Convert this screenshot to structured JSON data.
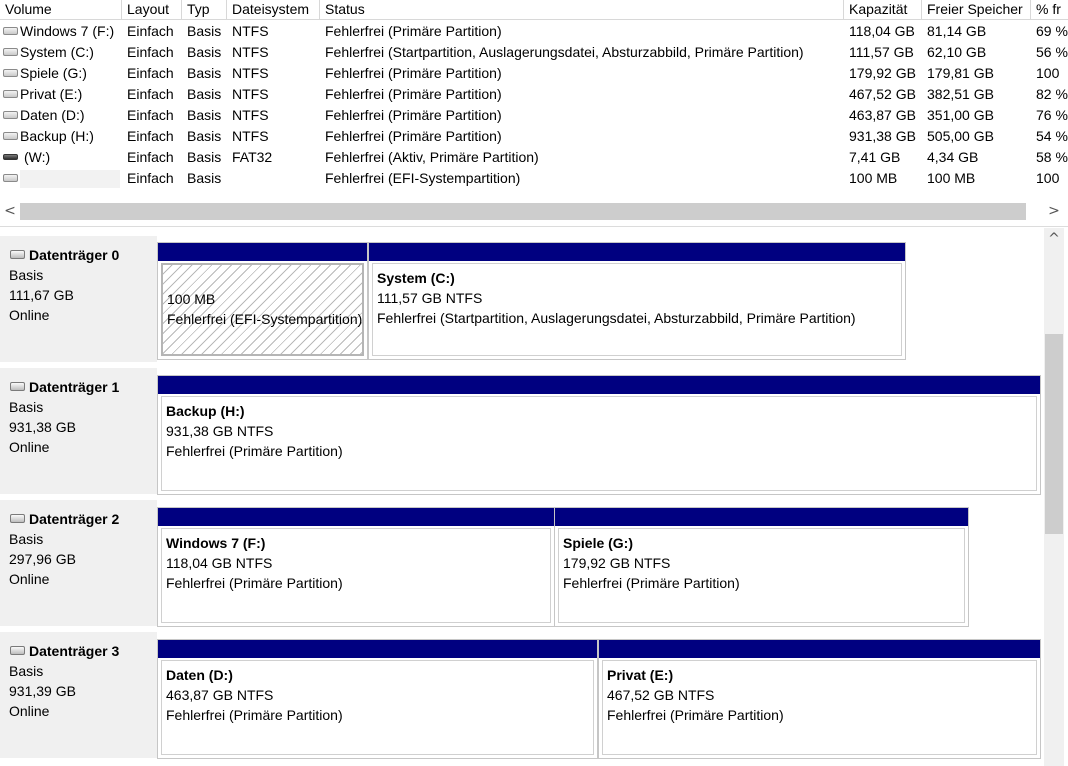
{
  "columns": [
    "Volume",
    "Layout",
    "Typ",
    "Dateisystem",
    "Status",
    "Kapazität",
    "Freier Speicher",
    "% fr"
  ],
  "volumes": [
    {
      "name": "Windows 7 (F:)",
      "layout": "Einfach",
      "type": "Basis",
      "fs": "NTFS",
      "status": "Fehlerfrei (Primäre Partition)",
      "capacity": "118,04 GB",
      "free": "81,14 GB",
      "pct": "69 %",
      "icon": "drive-icon"
    },
    {
      "name": "System (C:)",
      "layout": "Einfach",
      "type": "Basis",
      "fs": "NTFS",
      "status": "Fehlerfrei (Startpartition, Auslagerungsdatei, Absturzabbild, Primäre Partition)",
      "capacity": "111,57 GB",
      "free": "62,10 GB",
      "pct": "56 %",
      "icon": "drive-icon"
    },
    {
      "name": "Spiele (G:)",
      "layout": "Einfach",
      "type": "Basis",
      "fs": "NTFS",
      "status": "Fehlerfrei (Primäre Partition)",
      "capacity": "179,92 GB",
      "free": "179,81 GB",
      "pct": "100",
      "icon": "drive-icon"
    },
    {
      "name": "Privat (E:)",
      "layout": "Einfach",
      "type": "Basis",
      "fs": "NTFS",
      "status": "Fehlerfrei (Primäre Partition)",
      "capacity": "467,52 GB",
      "free": "382,51 GB",
      "pct": "82 %",
      "icon": "drive-icon"
    },
    {
      "name": "Daten (D:)",
      "layout": "Einfach",
      "type": "Basis",
      "fs": "NTFS",
      "status": "Fehlerfrei (Primäre Partition)",
      "capacity": "463,87 GB",
      "free": "351,00 GB",
      "pct": "76 %",
      "icon": "drive-icon"
    },
    {
      "name": "Backup (H:)",
      "layout": "Einfach",
      "type": "Basis",
      "fs": "NTFS",
      "status": "Fehlerfrei (Primäre Partition)",
      "capacity": "931,38 GB",
      "free": "505,00 GB",
      "pct": "54 %",
      "icon": "drive-icon"
    },
    {
      "name": "(W:)",
      "layout": "Einfach",
      "type": "Basis",
      "fs": "FAT32",
      "status": "Fehlerfrei (Aktiv, Primäre Partition)",
      "capacity": "7,41 GB",
      "free": "4,34 GB",
      "pct": "58 %",
      "icon": "removable-drive-icon"
    },
    {
      "name": "",
      "layout": "Einfach",
      "type": "Basis",
      "fs": "",
      "status": "Fehlerfrei (EFI-Systempartition)",
      "capacity": "100 MB",
      "free": "100 MB",
      "pct": "100",
      "icon": "drive-icon"
    }
  ],
  "scroll": {
    "left": "<",
    "right": ">",
    "up": "^"
  },
  "disks": [
    {
      "name": "Datenträger 0",
      "type": "Basis",
      "size": "111,67 GB",
      "state": "Online",
      "partitions": [
        {
          "name": "",
          "size": "100 MB",
          "status": "Fehlerfrei (EFI-Systempartition)"
        },
        {
          "name": "System  (C:)",
          "size": "111,57 GB NTFS",
          "status": "Fehlerfrei (Startpartition, Auslagerungsdatei, Absturzabbild, Primäre Partition)"
        }
      ]
    },
    {
      "name": "Datenträger 1",
      "type": "Basis",
      "size": "931,38 GB",
      "state": "Online",
      "partitions": [
        {
          "name": "Backup  (H:)",
          "size": "931,38 GB NTFS",
          "status": "Fehlerfrei (Primäre Partition)"
        }
      ]
    },
    {
      "name": "Datenträger 2",
      "type": "Basis",
      "size": "297,96 GB",
      "state": "Online",
      "partitions": [
        {
          "name": "Windows 7  (F:)",
          "size": "118,04 GB NTFS",
          "status": "Fehlerfrei (Primäre Partition)"
        },
        {
          "name": "Spiele  (G:)",
          "size": "179,92 GB NTFS",
          "status": "Fehlerfrei (Primäre Partition)"
        }
      ]
    },
    {
      "name": "Datenträger 3",
      "type": "Basis",
      "size": "931,39 GB",
      "state": "Online",
      "partitions": [
        {
          "name": "Daten  (D:)",
          "size": "463,87 GB NTFS",
          "status": "Fehlerfrei (Primäre Partition)"
        },
        {
          "name": "Privat  (E:)",
          "size": "467,52 GB NTFS",
          "status": "Fehlerfrei (Primäre Partition)"
        }
      ]
    }
  ],
  "colors": {
    "partition_bar": "#000080",
    "label_bg": "#f0f0f0"
  }
}
